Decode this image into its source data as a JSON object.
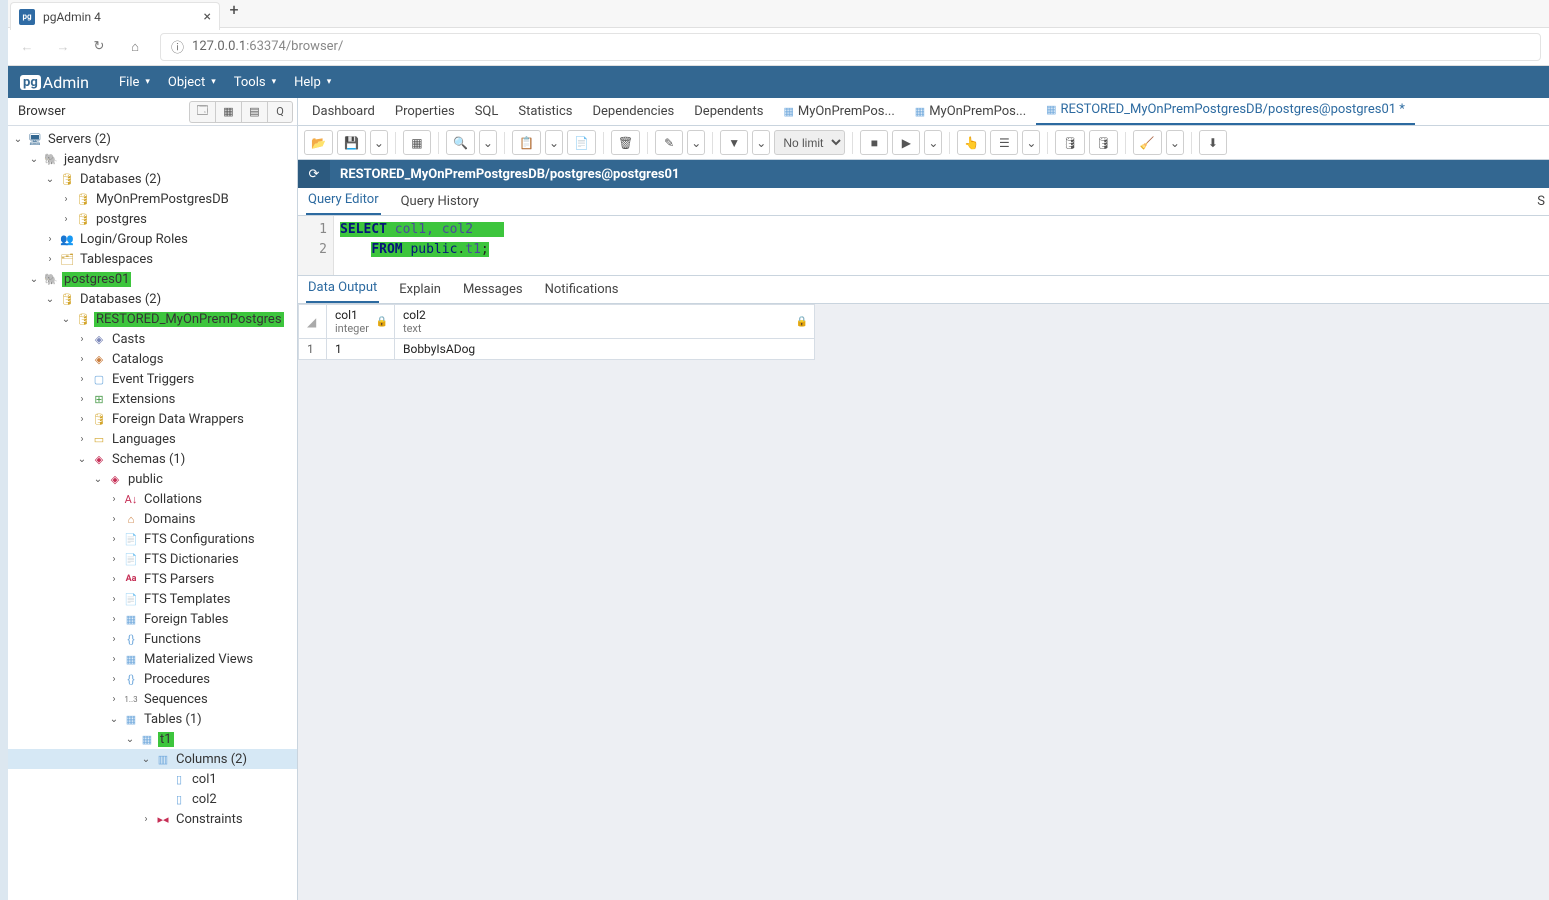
{
  "browser": {
    "tab_title": "pgAdmin 4",
    "url_host": "127.0.0.1",
    "url_path": ":63374/browser/"
  },
  "logo": "Admin",
  "menubar": {
    "file": "File",
    "object": "Object",
    "tools": "Tools",
    "help": "Help"
  },
  "sidebar": {
    "title": "Browser",
    "tree": {
      "servers": "Servers (2)",
      "jeanydsrv": "jeanydsrv",
      "databases1": "Databases (2)",
      "db_myonprem": "MyOnPremPostgresDB",
      "db_postgres": "postgres",
      "login_roles": "Login/Group Roles",
      "tablespaces": "Tablespaces",
      "postgres01": "postgres01",
      "databases2": "Databases (2)",
      "db_restored": "RESTORED_MyOnPremPostgres",
      "casts": "Casts",
      "catalogs": "Catalogs",
      "event_triggers": "Event Triggers",
      "extensions": "Extensions",
      "fdw": "Foreign Data Wrappers",
      "languages": "Languages",
      "schemas": "Schemas (1)",
      "public": "public",
      "collations": "Collations",
      "domains": "Domains",
      "fts_conf": "FTS Configurations",
      "fts_dict": "FTS Dictionaries",
      "fts_parsers": "FTS Parsers",
      "fts_templates": "FTS Templates",
      "foreign_tables": "Foreign Tables",
      "functions": "Functions",
      "mat_views": "Materialized Views",
      "procedures": "Procedures",
      "sequences": "Sequences",
      "tables": "Tables (1)",
      "t1": "t1",
      "columns": "Columns (2)",
      "col1": "col1",
      "col2": "col2",
      "constraints": "Constraints"
    }
  },
  "main_tabs": {
    "dashboard": "Dashboard",
    "properties": "Properties",
    "sql": "SQL",
    "statistics": "Statistics",
    "dependencies": "Dependencies",
    "dependents": "Dependents",
    "qt1": "MyOnPremPos...",
    "qt2": "MyOnPremPos...",
    "qt3": "RESTORED_MyOnPremPostgresDB/postgres@postgres01 *"
  },
  "toolbar": {
    "no_limit": "No limit"
  },
  "conn_text": "RESTORED_MyOnPremPostgresDB/postgres@postgres01",
  "query_tabs": {
    "editor": "Query Editor",
    "history": "Query History",
    "scratch": "S"
  },
  "sql": {
    "l1": "1",
    "l2": "2",
    "kw_select": "SELECT",
    "cols": " col1, col2",
    "kw_from": "FROM",
    "pub": " public",
    "dot": ".",
    "t1": "t1",
    "semi": ";"
  },
  "output_tabs": {
    "data": "Data Output",
    "explain": "Explain",
    "messages": "Messages",
    "notifications": "Notifications"
  },
  "grid": {
    "col1_name": "col1",
    "col1_type": "integer",
    "col2_name": "col2",
    "col2_type": "text",
    "rownum_1": "1",
    "row1_col1": "1",
    "row1_col2": "BobbyIsADog"
  }
}
